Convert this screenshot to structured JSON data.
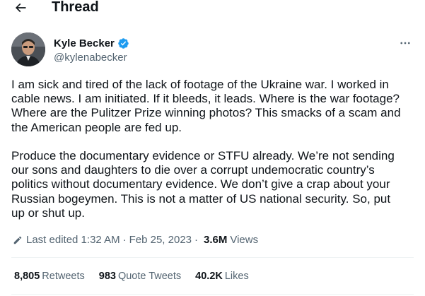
{
  "header": {
    "back_icon": "arrow-left-icon",
    "title": "Thread"
  },
  "author": {
    "name": "Kyle Becker",
    "handle": "@kylenabecker",
    "verified_color": "#1d9bf0",
    "verified_icon": "verified-badge-icon"
  },
  "more_icon": "more-horizontal-icon",
  "tweet": {
    "paragraphs": [
      [
        "I am sick and tired of the lack of footage of the Ukraine war. I worked in",
        "cable news. I am initiated. If it bleeds, it leads. Where is the war footage?",
        "Where are the Pulitzer Prize winning photos? This smacks of a scam and",
        "the American people are fed up."
      ],
      [
        "Produce the documentary evidence or STFU already. We’re not sending",
        "our sons and daughters to die over a corrupt undemocratic country’s",
        "politics without documentary evidence.  We don’t give a crap about your",
        "Russian bogeymen. This is not a matter of US national security. So, put",
        "up or shut up."
      ]
    ]
  },
  "meta": {
    "edit_icon": "pencil-icon",
    "edited_label": "Last edited 1:32 AM",
    "separator": "·",
    "date": "Feb 25, 2023",
    "views_count": "3.6M",
    "views_label": "Views"
  },
  "stats": [
    {
      "count": "8,805",
      "label": "Retweets"
    },
    {
      "count": "983",
      "label": "Quote Tweets"
    },
    {
      "count": "40.2K",
      "label": "Likes"
    }
  ]
}
